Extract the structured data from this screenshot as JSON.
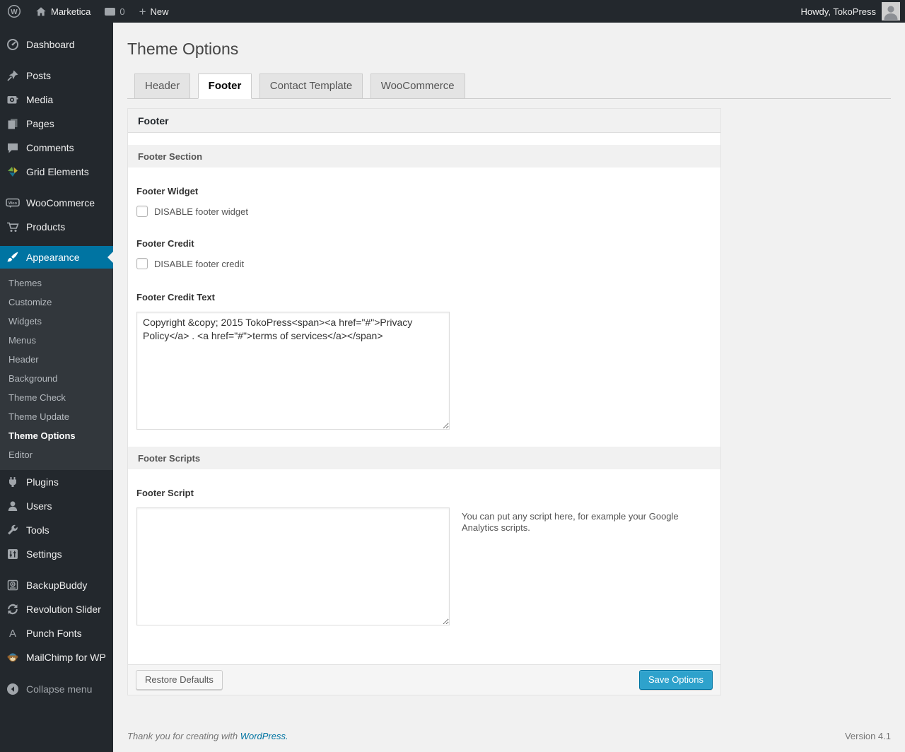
{
  "colors": {
    "accent": "#0074a2",
    "primary_button": "#2ea2cc",
    "admin_dark": "#23282d",
    "submenu_bg": "#32373c"
  },
  "icons": {
    "wp_logo_letter": "W",
    "woo_badge_text": "Woo",
    "punch_fonts_letter": "A",
    "plus": "+"
  },
  "admin_bar": {
    "site_name": "Marketica",
    "comment_count": "0",
    "new_label": "New",
    "howdy": "Howdy, TokoPress"
  },
  "sidebar": {
    "items": [
      {
        "label": "Dashboard",
        "icon": "dashboard-icon"
      },
      {
        "label": "Posts",
        "icon": "pushpin-icon"
      },
      {
        "label": "Media",
        "icon": "media-icon"
      },
      {
        "label": "Pages",
        "icon": "pages-icon"
      },
      {
        "label": "Comments",
        "icon": "comments-icon"
      },
      {
        "label": "Grid Elements",
        "icon": "grid-elements-icon"
      },
      {
        "label": "WooCommerce",
        "icon": "woocommerce-icon"
      },
      {
        "label": "Products",
        "icon": "cart-icon"
      },
      {
        "label": "Appearance",
        "icon": "brush-icon",
        "active": true
      },
      {
        "label": "Plugins",
        "icon": "plugin-icon"
      },
      {
        "label": "Users",
        "icon": "user-icon"
      },
      {
        "label": "Tools",
        "icon": "wrench-icon"
      },
      {
        "label": "Settings",
        "icon": "settings-icon"
      },
      {
        "label": "BackupBuddy",
        "icon": "backup-icon"
      },
      {
        "label": "Revolution Slider",
        "icon": "refresh-icon"
      },
      {
        "label": "Punch Fonts",
        "icon": "letter-a-icon"
      },
      {
        "label": "MailChimp for WP",
        "icon": "monkey-icon"
      }
    ],
    "appearance_submenu": [
      "Themes",
      "Customize",
      "Widgets",
      "Menus",
      "Header",
      "Background",
      "Theme Check",
      "Theme Update",
      "Theme Options",
      "Editor"
    ],
    "current_submenu_item": "Theme Options",
    "collapse_label": "Collapse menu"
  },
  "main": {
    "page_title": "Theme Options",
    "tabs": [
      {
        "label": "Header",
        "active": false
      },
      {
        "label": "Footer",
        "active": true
      },
      {
        "label": "Contact Template",
        "active": false
      },
      {
        "label": "WooCommerce",
        "active": false
      }
    ]
  },
  "panel": {
    "group_header": "Footer",
    "section_header": "Footer Section",
    "footer_widget_label": "Footer Widget",
    "footer_widget_checkbox_label": "DISABLE footer widget",
    "footer_widget_checked": false,
    "footer_credit_label": "Footer Credit",
    "footer_credit_checkbox_label": "DISABLE footer credit",
    "footer_credit_checked": false,
    "footer_credit_text_label": "Footer Credit Text",
    "footer_credit_value": "Copyright &copy; 2015 TokoPress<span><a href=\"#\">Privacy Policy</a> . <a href=\"#\">terms of services</a></span>",
    "scripts_header": "Footer Scripts",
    "footer_script_label": "Footer Script",
    "footer_script_value": "",
    "footer_script_hint": "You can put any script here, for example your Google Analytics scripts.",
    "restore_button": "Restore Defaults",
    "save_button": "Save Options"
  },
  "page_footer": {
    "thanks_prefix": "Thank you for creating with",
    "wordpress_link": "WordPress.",
    "version": "Version 4.1"
  }
}
